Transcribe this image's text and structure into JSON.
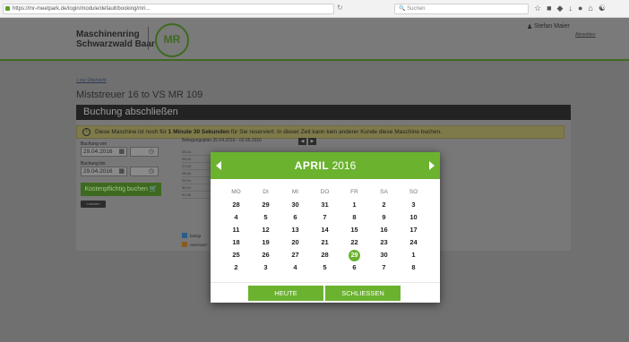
{
  "browser": {
    "url": "https://mr-meetpark.de/login/module/default/booking/mri...",
    "search_placeholder": "Suchen",
    "reload_icon": "reload-icon",
    "toolbar_icons": [
      "star-icon",
      "library-icon",
      "pocket-icon",
      "download-icon",
      "sync-icon",
      "home-icon",
      "extension-icon"
    ]
  },
  "header": {
    "brand_line1": "Maschinenring",
    "brand_line2": "Schwarzwald Baar",
    "logo_text": "MR",
    "user_name": "Stefan Maier",
    "logout": "Abmelden"
  },
  "main": {
    "back_link": "« zur Übersicht",
    "title": "Miststreuer 16 to VS MR 109",
    "section_title": "Buchung abschließen",
    "notice_prefix": "Diese Maschine ist noch für ",
    "notice_bold": "1 Minute 30 Sekunden",
    "notice_suffix": " für Sie reserviert. In dieser Zeit kann kein anderer Kunde diese Maschine buchen.",
    "from_label": "Buchung von",
    "from_date": "29.04.2016",
    "to_label": "Buchung bis",
    "to_date": "29.04.2016",
    "book_button": "Kostenpflichtig buchen",
    "clear_button": "Löschen",
    "plan_label": "Belegungsplan 25.04.2016 - 02.05.2016",
    "plan_rows": [
      "25.04",
      "26.04",
      "27.04",
      "28.04",
      "29.04",
      "30.04",
      "01.05"
    ],
    "legend_booked": "belegt",
    "legend_reserved": "reserviert"
  },
  "datepicker": {
    "month": "APRIL",
    "year": "2016",
    "weekdays": [
      "MO",
      "DI",
      "MI",
      "DO",
      "FR",
      "SA",
      "SO"
    ],
    "weeks": [
      [
        {
          "d": "28"
        },
        {
          "d": "29"
        },
        {
          "d": "30"
        },
        {
          "d": "31"
        },
        {
          "d": "1"
        },
        {
          "d": "2"
        },
        {
          "d": "3"
        }
      ],
      [
        {
          "d": "4"
        },
        {
          "d": "5"
        },
        {
          "d": "6"
        },
        {
          "d": "7"
        },
        {
          "d": "8"
        },
        {
          "d": "9"
        },
        {
          "d": "10"
        }
      ],
      [
        {
          "d": "11"
        },
        {
          "d": "12"
        },
        {
          "d": "13"
        },
        {
          "d": "14"
        },
        {
          "d": "15"
        },
        {
          "d": "16"
        },
        {
          "d": "17"
        }
      ],
      [
        {
          "d": "18"
        },
        {
          "d": "19"
        },
        {
          "d": "20"
        },
        {
          "d": "21"
        },
        {
          "d": "22"
        },
        {
          "d": "23"
        },
        {
          "d": "24"
        }
      ],
      [
        {
          "d": "25"
        },
        {
          "d": "26"
        },
        {
          "d": "27"
        },
        {
          "d": "28"
        },
        {
          "d": "29",
          "today": true
        },
        {
          "d": "30"
        },
        {
          "d": "1"
        }
      ],
      [
        {
          "d": "2"
        },
        {
          "d": "3"
        },
        {
          "d": "4"
        },
        {
          "d": "5"
        },
        {
          "d": "6"
        },
        {
          "d": "7"
        },
        {
          "d": "8"
        }
      ]
    ],
    "today_button": "HEUTE",
    "close_button": "SCHLIESSEN"
  },
  "colors": {
    "accent_green": "#6bb22f",
    "dark_green": "#3d6a1f",
    "section_bar": "#232323"
  }
}
